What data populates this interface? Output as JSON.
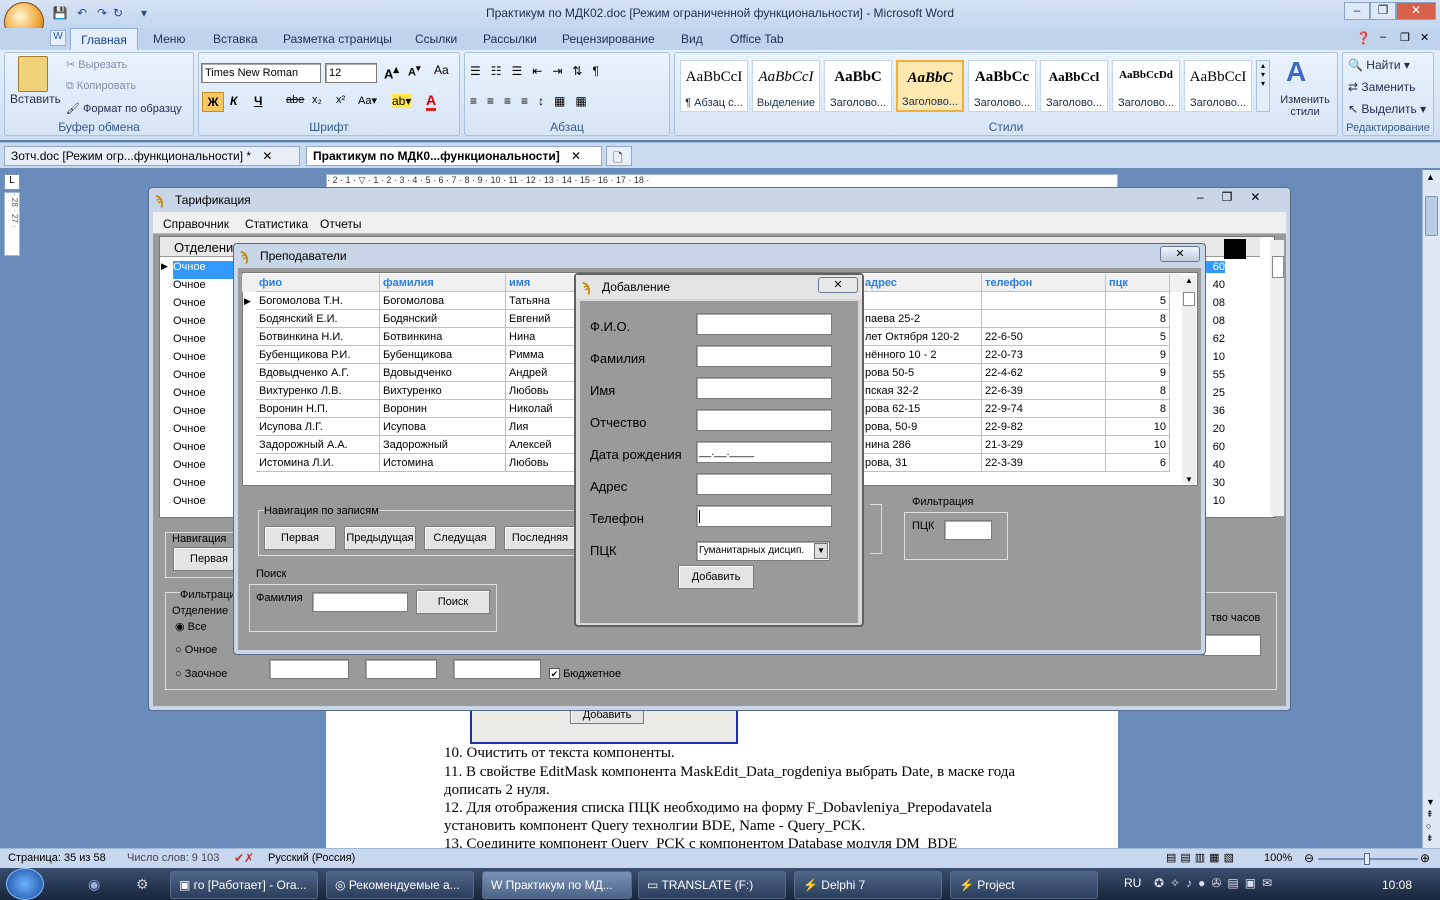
{
  "word": {
    "title": "Практикум по МДК02.doc [Режим ограниченной функциональности] - Microsoft Word",
    "tabs": [
      "Главная",
      "Меню",
      "Вставка",
      "Разметка страницы",
      "Ссылки",
      "Рассылки",
      "Рецензирование",
      "Вид",
      "Office Tab"
    ],
    "clipboard": {
      "paste": "Вставить",
      "cut": "Вырезать",
      "copy": "Копировать",
      "format": "Формат по образцу",
      "label": "Буфер обмена"
    },
    "font": {
      "name": "Times New Roman",
      "size": "12",
      "label": "Шрифт"
    },
    "paragraph_label": "Абзац",
    "styles": [
      {
        "sample": "AaBbCcI",
        "name": "¶ Абзац с..."
      },
      {
        "sample": "AaBbCcI",
        "name": "Выделение"
      },
      {
        "sample": "AaBbC",
        "name": "Заголово..."
      },
      {
        "sample": "AaBbC",
        "name": "Заголово..."
      },
      {
        "sample": "AaBbCc",
        "name": "Заголово..."
      },
      {
        "sample": "AaBbCcl",
        "name": "Заголово..."
      },
      {
        "sample": "AaBbCcDd",
        "name": "Заголово..."
      },
      {
        "sample": "AaBbCcI",
        "name": "Заголово..."
      }
    ],
    "styles_label": "Стили",
    "change_styles": "Изменить стили",
    "editing": {
      "find": "Найти",
      "replace": "Заменить",
      "select": "Выделить",
      "label": "Редактирование"
    },
    "doc_tabs": [
      "Зотч.doc [Режим огр...функциональности] *",
      "Практикум по МДК0...функциональности]"
    ],
    "ruler": "· 2 · 1 · ▽ · 1 · 2 · 3 · 4 · 5 · 6 · 7 · 8 · 9 · 10 · 11 · 12 · 13 · 14 · 15 · 16 · 17 · 18 ·",
    "doc_lines": [
      "10. Очистить от текста компоненты.",
      "11. В свойстве EditMask компонента MaskEdit_Data_rogdeniya выбрать Date, в маске года",
      "      дописать 2 нуля.",
      "12. Для отображения списка ПЦК необходимо на форму F_Dobavleniya_Prepodavatela",
      "      установить компонент Query технолгии BDE, Name - Query_PCK.",
      "13. Соедините компонент Query_PCK с компонентом Database модуля DM_BDE"
    ],
    "doc_button": "Добавить",
    "status": {
      "page": "Страница: 35 из 58",
      "words": "Число слов: 9 103",
      "lang": "Русский (Россия)",
      "zoom": "100%"
    }
  },
  "taskbar": {
    "items": [
      "го [Работает] - Ora...",
      "Рекомендуемые а...",
      "Практикум по МД...",
      "TRANSLATE (F:)",
      "Delphi 7",
      "Project"
    ],
    "lang": "RU",
    "time": "10:08"
  },
  "tarif": {
    "title": "Тарификация",
    "menu": [
      "Справочник",
      "Статистика",
      "Отчеты"
    ],
    "col": "Отделение",
    "rows": [
      "Очное",
      "Очное",
      "Очное",
      "Очное",
      "Очное",
      "Очное",
      "Очное",
      "Очное",
      "Очное",
      "Очное",
      "Очное",
      "Очное",
      "Очное",
      "Очное"
    ],
    "right_vals": [
      "60",
      "40",
      "08",
      "08",
      "62",
      "10",
      "55",
      "25",
      "36",
      "20",
      "60",
      "40",
      "30",
      "10"
    ],
    "nav": "Навигация",
    "first": "Первая",
    "filter": "Фильтрация",
    "dept": "Отделение",
    "radios": [
      "Все",
      "Очное",
      "Заочное"
    ],
    "budget": "Бюджетное",
    "hours": "тво часов"
  },
  "prep": {
    "title": "Преподаватели",
    "headers": [
      "фио",
      "фамилия",
      "имя",
      "",
      "адрес",
      "телефон",
      "пцк"
    ],
    "rows": [
      [
        "Богомолова Т.Н.",
        "Богомолова",
        "Татьяна",
        "",
        "",
        "",
        "5"
      ],
      [
        "Бодянский Е.И.",
        "Бодянский",
        "Евгений",
        "",
        "паева  25-2",
        "",
        "8"
      ],
      [
        "Ботвинкина Н.И.",
        "Ботвинкина",
        "Нина",
        "",
        "лет Октября 120-2",
        "22-6-50",
        "5"
      ],
      [
        "Бубенщикова Р.И.",
        "Бубенщикова",
        "Римма",
        "",
        "нённого 10 - 2",
        "22-0-73",
        "9"
      ],
      [
        "Вдовыдченко А.Г.",
        "Вдовыдченко",
        "Андрей",
        "",
        "рова 50-5",
        "22-4-62",
        "9"
      ],
      [
        "Вихтуренко Л.В.",
        "Вихтуренко",
        "Любовь",
        "",
        "пская 32-2",
        "22-6-39",
        "8"
      ],
      [
        "Воронин Н.П.",
        "Воронин",
        "Николай",
        "",
        "рова 62-15",
        "22-9-74",
        "8"
      ],
      [
        "Исупова Л.Г.",
        "Исупова",
        "Лия",
        "",
        "рова, 50-9",
        "22-9-82",
        "10"
      ],
      [
        "Задорожный А.А.",
        "Задорожный",
        "Алексей",
        "",
        "нина 286",
        "21-3-29",
        "10"
      ],
      [
        "Истомина Л.И.",
        "Истомина",
        "Любовь",
        "",
        "рова, 31",
        "22-3-39",
        "6"
      ]
    ],
    "nav": "Навигация по записям",
    "nav_buttons": [
      "Первая",
      "Предыдущая",
      "Следущая",
      "Последняя"
    ],
    "search": "Поиск",
    "surname": "Фамилия",
    "search_btn": "Поиск",
    "filter": "Фильтрация",
    "pck": "ПЦК"
  },
  "add": {
    "title": "Добавление",
    "fields": [
      "Ф.И.О.",
      "Фамилия",
      "Имя",
      "Отчество",
      "Дата рождения",
      "Адрес",
      "Телефон",
      "ПЦК"
    ],
    "date_mask": "__.__.____",
    "pck_value": "Гуманитарных дисцип.",
    "button": "Добавить"
  }
}
